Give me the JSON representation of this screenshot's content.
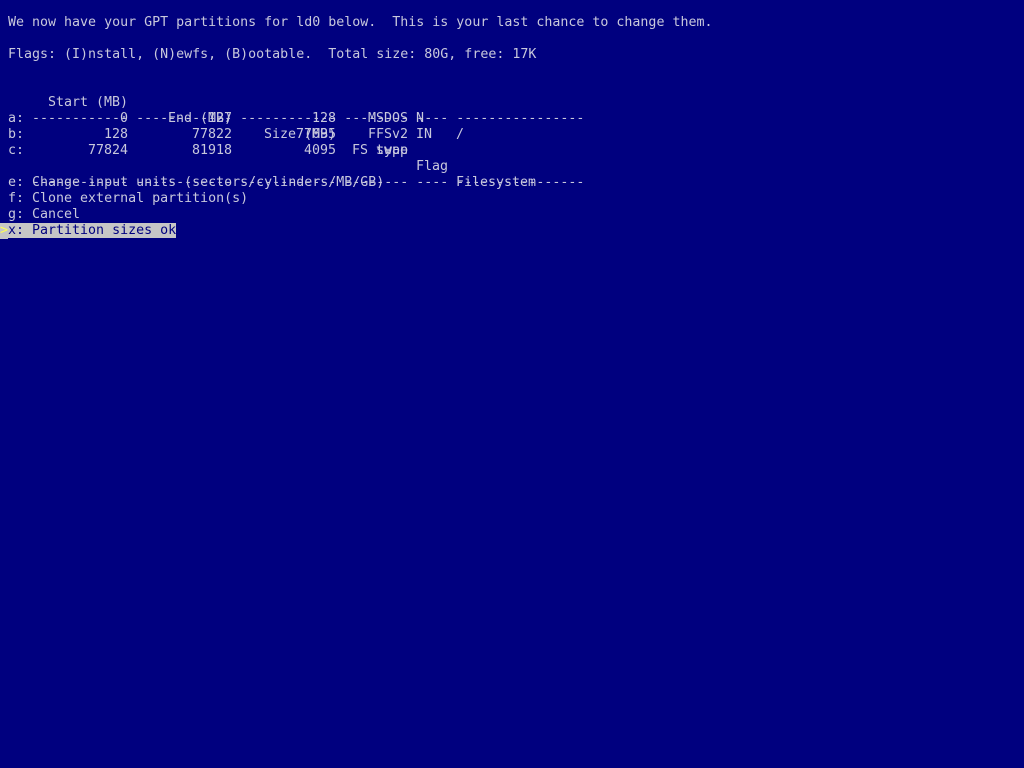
{
  "header": {
    "intro": "We now have your GPT partitions for ld0 below.  This is your last chance to change them.",
    "flags_line": "Flags: (I)nstall, (N)ewfs, (B)ootable.  Total size: 80G, free: 17K"
  },
  "table": {
    "columns": [
      "Start (MB)",
      "End (MB)",
      "Size (MB)",
      "FS type",
      "Flag",
      "Filesystem"
    ],
    "rows": [
      {
        "key": "a:",
        "start": "0",
        "end": "127",
        "size": "128",
        "fstype": "MSDOS",
        "flag": "N",
        "filesystem": ""
      },
      {
        "key": "b:",
        "start": "128",
        "end": "77822",
        "size": "77695",
        "fstype": "FFSv2",
        "flag": "IN",
        "filesystem": "/"
      },
      {
        "key": "c:",
        "start": "77824",
        "end": "81918",
        "size": "4095",
        "fstype": "swap",
        "flag": "",
        "filesystem": ""
      }
    ]
  },
  "menu": {
    "cursor": ">",
    "items": [
      {
        "key": "e",
        "label": "e: Change input units (sectors/cylinders/MB/GB)",
        "selected": false
      },
      {
        "key": "f",
        "label": "f: Clone external partition(s)",
        "selected": false
      },
      {
        "key": "g",
        "label": "g: Cancel",
        "selected": false
      },
      {
        "key": "x",
        "label": "x: Partition sizes ok",
        "selected": true
      }
    ]
  },
  "colors": {
    "background": "#00007f",
    "text": "#c8c8dc",
    "highlight_bg": "#c6c6c6",
    "cursor": "#ffff55"
  }
}
